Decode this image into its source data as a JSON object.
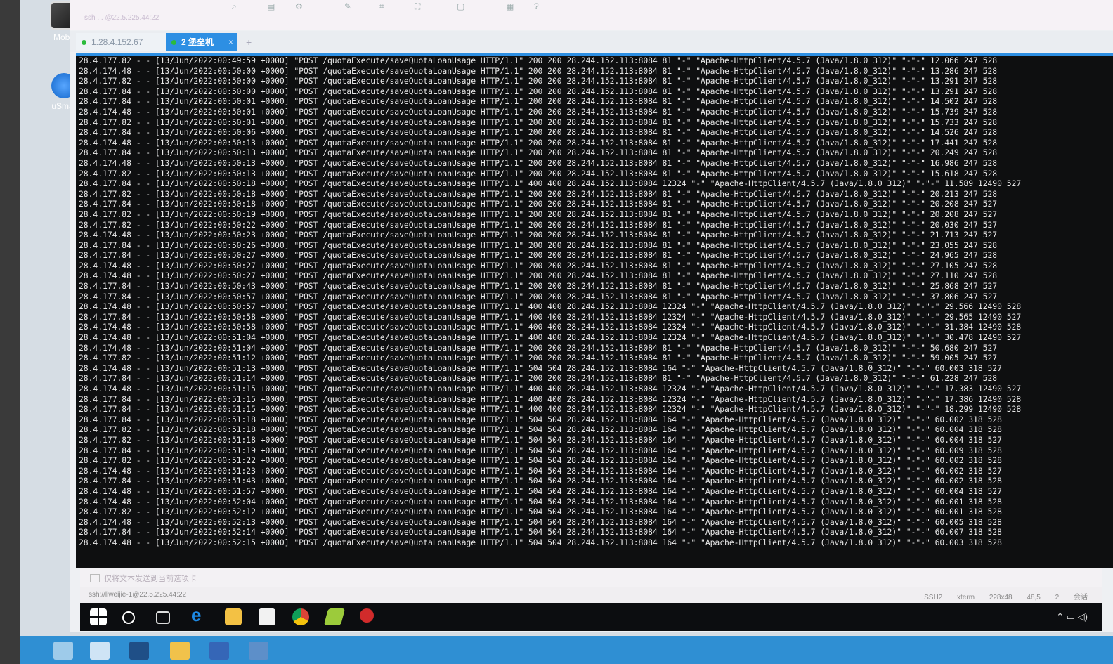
{
  "desktop": {
    "icons": [
      {
        "label": "Moba",
        "icon": "mobaxterm-icon"
      },
      {
        "label": "uSmar",
        "icon": "usmart-icon"
      }
    ]
  },
  "window": {
    "address": "ssh ... @22.5.225.44:22",
    "tabs": [
      {
        "label": "1.28.4.152.67",
        "status": "connected"
      },
      {
        "label": "2 堡垒机",
        "status": "connected",
        "active": true
      }
    ],
    "add_tab": "+"
  },
  "terminal": {
    "lines": [
      "28.4.177.82 - - [13/Jun/2022:00:49:59 +0000] \"POST /quotaExecute/saveQuotaLoanUsage HTTP/1.1\" 200 200 28.244.152.113:8084 81 \"-\" \"Apache-HttpClient/4.5.7 (Java/1.8.0_312)\" \"-\"-\" 12.066 247 528",
      "28.4.174.48 - - [13/Jun/2022:00:50:00 +0000] \"POST /quotaExecute/saveQuotaLoanUsage HTTP/1.1\" 200 200 28.244.152.113:8084 81 \"-\" \"Apache-HttpClient/4.5.7 (Java/1.8.0_312)\" \"-\"-\" 13.286 247 528",
      "28.4.177.82 - - [13/Jun/2022:00:50:00 +0000] \"POST /quotaExecute/saveQuotaLoanUsage HTTP/1.1\" 200 200 28.244.152.113:8084 81 \"-\" \"Apache-HttpClient/4.5.7 (Java/1.8.0_312)\" \"-\"-\" 13.291 247 528",
      "28.4.177.84 - - [13/Jun/2022:00:50:00 +0000] \"POST /quotaExecute/saveQuotaLoanUsage HTTP/1.1\" 200 200 28.244.152.113:8084 81 \"-\" \"Apache-HttpClient/4.5.7 (Java/1.8.0_312)\" \"-\"-\" 13.291 247 528",
      "28.4.177.84 - - [13/Jun/2022:00:50:01 +0000] \"POST /quotaExecute/saveQuotaLoanUsage HTTP/1.1\" 200 200 28.244.152.113:8084 81 \"-\" \"Apache-HttpClient/4.5.7 (Java/1.8.0_312)\" \"-\"-\" 14.502 247 528",
      "28.4.174.48 - - [13/Jun/2022:00:50:01 +0000] \"POST /quotaExecute/saveQuotaLoanUsage HTTP/1.1\" 200 200 28.244.152.113:8084 81 \"-\" \"Apache-HttpClient/4.5.7 (Java/1.8.0_312)\" \"-\"-\" 15.739 247 528",
      "28.4.177.82 - - [13/Jun/2022:00:50:01 +0000] \"POST /quotaExecute/saveQuotaLoanUsage HTTP/1.1\" 200 200 28.244.152.113:8084 81 \"-\" \"Apache-HttpClient/4.5.7 (Java/1.8.0_312)\" \"-\"-\" 15.733 247 528",
      "28.4.177.84 - - [13/Jun/2022:00:50:06 +0000] \"POST /quotaExecute/saveQuotaLoanUsage HTTP/1.1\" 200 200 28.244.152.113:8084 81 \"-\" \"Apache-HttpClient/4.5.7 (Java/1.8.0_312)\" \"-\"-\" 14.526 247 528",
      "28.4.174.48 - - [13/Jun/2022:00:50:13 +0000] \"POST /quotaExecute/saveQuotaLoanUsage HTTP/1.1\" 200 200 28.244.152.113:8084 81 \"-\" \"Apache-HttpClient/4.5.7 (Java/1.8.0_312)\" \"-\"-\" 17.441 247 528",
      "28.4.177.84 - - [13/Jun/2022:00:50:13 +0000] \"POST /quotaExecute/saveQuotaLoanUsage HTTP/1.1\" 200 200 28.244.152.113:8084 81 \"-\" \"Apache-HttpClient/4.5.7 (Java/1.8.0_312)\" \"-\"-\" 20.249 247 528",
      "28.4.174.48 - - [13/Jun/2022:00:50:13 +0000] \"POST /quotaExecute/saveQuotaLoanUsage HTTP/1.1\" 200 200 28.244.152.113:8084 81 \"-\" \"Apache-HttpClient/4.5.7 (Java/1.8.0_312)\" \"-\"-\" 16.986 247 528",
      "28.4.177.82 - - [13/Jun/2022:00:50:13 +0000] \"POST /quotaExecute/saveQuotaLoanUsage HTTP/1.1\" 200 200 28.244.152.113:8084 81 \"-\" \"Apache-HttpClient/4.5.7 (Java/1.8.0_312)\" \"-\"-\" 15.618 247 528",
      "28.4.177.84 - - [13/Jun/2022:00:50:18 +0000] \"POST /quotaExecute/saveQuotaLoanUsage HTTP/1.1\" 400 400 28.244.152.113:8084 12324 \"-\" \"Apache-HttpClient/4.5.7 (Java/1.8.0_312)\" \"-\"-\" 11.589 12490 527",
      "28.4.177.82 - - [13/Jun/2022:00:50:18 +0000] \"POST /quotaExecute/saveQuotaLoanUsage HTTP/1.1\" 200 200 28.244.152.113:8084 81 \"-\" \"Apache-HttpClient/4.5.7 (Java/1.8.0_312)\" \"-\"-\" 20.213 247 528",
      "28.4.177.84 - - [13/Jun/2022:00:50:18 +0000] \"POST /quotaExecute/saveQuotaLoanUsage HTTP/1.1\" 200 200 28.244.152.113:8084 81 \"-\" \"Apache-HttpClient/4.5.7 (Java/1.8.0_312)\" \"-\"-\" 20.208 247 527",
      "28.4.177.82 - - [13/Jun/2022:00:50:19 +0000] \"POST /quotaExecute/saveQuotaLoanUsage HTTP/1.1\" 200 200 28.244.152.113:8084 81 \"-\" \"Apache-HttpClient/4.5.7 (Java/1.8.0_312)\" \"-\"-\" 20.208 247 527",
      "28.4.177.82 - - [13/Jun/2022:00:50:22 +0000] \"POST /quotaExecute/saveQuotaLoanUsage HTTP/1.1\" 200 200 28.244.152.113:8084 81 \"-\" \"Apache-HttpClient/4.5.7 (Java/1.8.0_312)\" \"-\"-\" 20.030 247 527",
      "28.4.174.48 - - [13/Jun/2022:00:50:23 +0000] \"POST /quotaExecute/saveQuotaLoanUsage HTTP/1.1\" 200 200 28.244.152.113:8084 81 \"-\" \"Apache-HttpClient/4.5.7 (Java/1.8.0_312)\" \"-\"-\" 21.713 247 527",
      "28.4.177.84 - - [13/Jun/2022:00:50:26 +0000] \"POST /quotaExecute/saveQuotaLoanUsage HTTP/1.1\" 200 200 28.244.152.113:8084 81 \"-\" \"Apache-HttpClient/4.5.7 (Java/1.8.0_312)\" \"-\"-\" 23.055 247 528",
      "28.4.177.84 - - [13/Jun/2022:00:50:27 +0000] \"POST /quotaExecute/saveQuotaLoanUsage HTTP/1.1\" 200 200 28.244.152.113:8084 81 \"-\" \"Apache-HttpClient/4.5.7 (Java/1.8.0_312)\" \"-\"-\" 24.965 247 528",
      "28.4.174.48 - - [13/Jun/2022:00:50:27 +0000] \"POST /quotaExecute/saveQuotaLoanUsage HTTP/1.1\" 200 200 28.244.152.113:8084 81 \"-\" \"Apache-HttpClient/4.5.7 (Java/1.8.0_312)\" \"-\"-\" 27.105 247 528",
      "28.4.174.48 - - [13/Jun/2022:00:50:27 +0000] \"POST /quotaExecute/saveQuotaLoanUsage HTTP/1.1\" 200 200 28.244.152.113:8084 81 \"-\" \"Apache-HttpClient/4.5.7 (Java/1.8.0_312)\" \"-\"-\" 27.110 247 528",
      "28.4.177.84 - - [13/Jun/2022:00:50:43 +0000] \"POST /quotaExecute/saveQuotaLoanUsage HTTP/1.1\" 200 200 28.244.152.113:8084 81 \"-\" \"Apache-HttpClient/4.5.7 (Java/1.8.0_312)\" \"-\"-\" 25.868 247 527",
      "28.4.177.84 - - [13/Jun/2022:00:50:57 +0000] \"POST /quotaExecute/saveQuotaLoanUsage HTTP/1.1\" 200 200 28.244.152.113:8084 81 \"-\" \"Apache-HttpClient/4.5.7 (Java/1.8.0_312)\" \"-\"-\" 37.806 247 527",
      "28.4.174.48 - - [13/Jun/2022:00:50:57 +0000] \"POST /quotaExecute/saveQuotaLoanUsage HTTP/1.1\" 400 400 28.244.152.113:8084 12324 \"-\" \"Apache-HttpClient/4.5.7 (Java/1.8.0_312)\" \"-\"-\" 29.566 12490 528",
      "28.4.177.84 - - [13/Jun/2022:00:50:58 +0000] \"POST /quotaExecute/saveQuotaLoanUsage HTTP/1.1\" 400 400 28.244.152.113:8084 12324 \"-\" \"Apache-HttpClient/4.5.7 (Java/1.8.0_312)\" \"-\"-\" 29.565 12490 527",
      "28.4.174.48 - - [13/Jun/2022:00:50:58 +0000] \"POST /quotaExecute/saveQuotaLoanUsage HTTP/1.1\" 400 400 28.244.152.113:8084 12324 \"-\" \"Apache-HttpClient/4.5.7 (Java/1.8.0_312)\" \"-\"-\" 31.384 12490 528",
      "28.4.174.48 - - [13/Jun/2022:00:51:04 +0000] \"POST /quotaExecute/saveQuotaLoanUsage HTTP/1.1\" 400 400 28.244.152.113:8084 12324 \"-\" \"Apache-HttpClient/4.5.7 (Java/1.8.0_312)\" \"-\"-\" 30.478 12490 527",
      "28.4.174.48 - - [13/Jun/2022:00:51:04 +0000] \"POST /quotaExecute/saveQuotaLoanUsage HTTP/1.1\" 200 200 28.244.152.113:8084 81 \"-\" \"Apache-HttpClient/4.5.7 (Java/1.8.0_312)\" \"-\"-\" 50.680 247 527",
      "28.4.177.82 - - [13/Jun/2022:00:51:12 +0000] \"POST /quotaExecute/saveQuotaLoanUsage HTTP/1.1\" 200 200 28.244.152.113:8084 81 \"-\" \"Apache-HttpClient/4.5.7 (Java/1.8.0_312)\" \"-\"-\" 59.005 247 527",
      "28.4.174.48 - - [13/Jun/2022:00:51:13 +0000] \"POST /quotaExecute/saveQuotaLoanUsage HTTP/1.1\" 504 504 28.244.152.113:8084 164 \"-\" \"Apache-HttpClient/4.5.7 (Java/1.8.0_312)\" \"-\"-\" 60.003 318 527",
      "28.4.177.84 - - [13/Jun/2022:00:51:14 +0000] \"POST /quotaExecute/saveQuotaLoanUsage HTTP/1.1\" 200 200 28.244.152.113:8084 81 \"-\" \"Apache-HttpClient/4.5.7 (Java/1.8.0_312)\" \"-\"-\" 61.228 247 528",
      "28.4.174.48 - - [13/Jun/2022:00:51:15 +0000] \"POST /quotaExecute/saveQuotaLoanUsage HTTP/1.1\" 400 400 28.244.152.113:8084 12324 \"-\" \"Apache-HttpClient/4.5.7 (Java/1.8.0_312)\" \"-\"-\" 17.383 12490 527",
      "28.4.177.84 - - [13/Jun/2022:00:51:15 +0000] \"POST /quotaExecute/saveQuotaLoanUsage HTTP/1.1\" 400 400 28.244.152.113:8084 12324 \"-\" \"Apache-HttpClient/4.5.7 (Java/1.8.0_312)\" \"-\"-\" 17.386 12490 528",
      "28.4.177.84 - - [13/Jun/2022:00:51:15 +0000] \"POST /quotaExecute/saveQuotaLoanUsage HTTP/1.1\" 400 400 28.244.152.113:8084 12324 \"-\" \"Apache-HttpClient/4.5.7 (Java/1.8.0_312)\" \"-\"-\" 18.299 12490 528",
      "28.4.177.84 - - [13/Jun/2022:00:51:18 +0000] \"POST /quotaExecute/saveQuotaLoanUsage HTTP/1.1\" 504 504 28.244.152.113:8084 164 \"-\" \"Apache-HttpClient/4.5.7 (Java/1.8.0_312)\" \"-\"-\" 60.002 318 528",
      "28.4.177.82 - - [13/Jun/2022:00:51:18 +0000] \"POST /quotaExecute/saveQuotaLoanUsage HTTP/1.1\" 504 504 28.244.152.113:8084 164 \"-\" \"Apache-HttpClient/4.5.7 (Java/1.8.0_312)\" \"-\"-\" 60.004 318 528",
      "28.4.177.82 - - [13/Jun/2022:00:51:18 +0000] \"POST /quotaExecute/saveQuotaLoanUsage HTTP/1.1\" 504 504 28.244.152.113:8084 164 \"-\" \"Apache-HttpClient/4.5.7 (Java/1.8.0_312)\" \"-\"-\" 60.004 318 527",
      "28.4.177.84 - - [13/Jun/2022:00:51:19 +0000] \"POST /quotaExecute/saveQuotaLoanUsage HTTP/1.1\" 504 504 28.244.152.113:8084 164 \"-\" \"Apache-HttpClient/4.5.7 (Java/1.8.0_312)\" \"-\"-\" 60.009 318 528",
      "28.4.177.82 - - [13/Jun/2022:00:51:22 +0000] \"POST /quotaExecute/saveQuotaLoanUsage HTTP/1.1\" 504 504 28.244.152.113:8084 164 \"-\" \"Apache-HttpClient/4.5.7 (Java/1.8.0_312)\" \"-\"-\" 60.002 318 528",
      "28.4.174.48 - - [13/Jun/2022:00:51:23 +0000] \"POST /quotaExecute/saveQuotaLoanUsage HTTP/1.1\" 504 504 28.244.152.113:8084 164 \"-\" \"Apache-HttpClient/4.5.7 (Java/1.8.0_312)\" \"-\"-\" 60.002 318 527",
      "28.4.177.84 - - [13/Jun/2022:00:51:43 +0000] \"POST /quotaExecute/saveQuotaLoanUsage HTTP/1.1\" 504 504 28.244.152.113:8084 164 \"-\" \"Apache-HttpClient/4.5.7 (Java/1.8.0_312)\" \"-\"-\" 60.002 318 528",
      "28.4.174.48 - - [13/Jun/2022:00:51:57 +0000] \"POST /quotaExecute/saveQuotaLoanUsage HTTP/1.1\" 504 504 28.244.152.113:8084 164 \"-\" \"Apache-HttpClient/4.5.7 (Java/1.8.0_312)\" \"-\"-\" 60.004 318 527",
      "28.4.174.48 - - [13/Jun/2022:00:52:04 +0000] \"POST /quotaExecute/saveQuotaLoanUsage HTTP/1.1\" 504 504 28.244.152.113:8084 164 \"-\" \"Apache-HttpClient/4.5.7 (Java/1.8.0_312)\" \"-\"-\" 60.001 318 528",
      "28.4.177.82 - - [13/Jun/2022:00:52:12 +0000] \"POST /quotaExecute/saveQuotaLoanUsage HTTP/1.1\" 504 504 28.244.152.113:8084 164 \"-\" \"Apache-HttpClient/4.5.7 (Java/1.8.0_312)\" \"-\"-\" 60.001 318 528",
      "28.4.174.48 - - [13/Jun/2022:00:52:13 +0000] \"POST /quotaExecute/saveQuotaLoanUsage HTTP/1.1\" 504 504 28.244.152.113:8084 164 \"-\" \"Apache-HttpClient/4.5.7 (Java/1.8.0_312)\" \"-\"-\" 60.005 318 528",
      "28.4.177.84 - - [13/Jun/2022:00:52:14 +0000] \"POST /quotaExecute/saveQuotaLoanUsage HTTP/1.1\" 504 504 28.244.152.113:8084 164 \"-\" \"Apache-HttpClient/4.5.7 (Java/1.8.0_312)\" \"-\"-\" 60.007 318 528",
      "28.4.174.48 - - [13/Jun/2022:00:52:15 +0000] \"POST /quotaExecute/saveQuotaLoanUsage HTTP/1.1\" 504 504 28.244.152.113:8084 164 \"-\" \"Apache-HttpClient/4.5.7 (Java/1.8.0_312)\" \"-\"-\" 60.003 318 528"
    ]
  },
  "input_bar": {
    "placeholder": "仅将文本发送到当前选项卡"
  },
  "status_bar": {
    "connection": "ssh://liweijie-1@22.5.225.44:22",
    "right": [
      "SSH2",
      "xterm",
      "228x48",
      "48,5",
      "2 会话"
    ]
  },
  "colors": {
    "accent": "#2d8fe3",
    "terminal_bg": "#0e0f10",
    "terminal_fg": "#e8e8e8",
    "inner_taskbar": "#0c0d10",
    "outer_taskbar": "#2f8fd3"
  }
}
